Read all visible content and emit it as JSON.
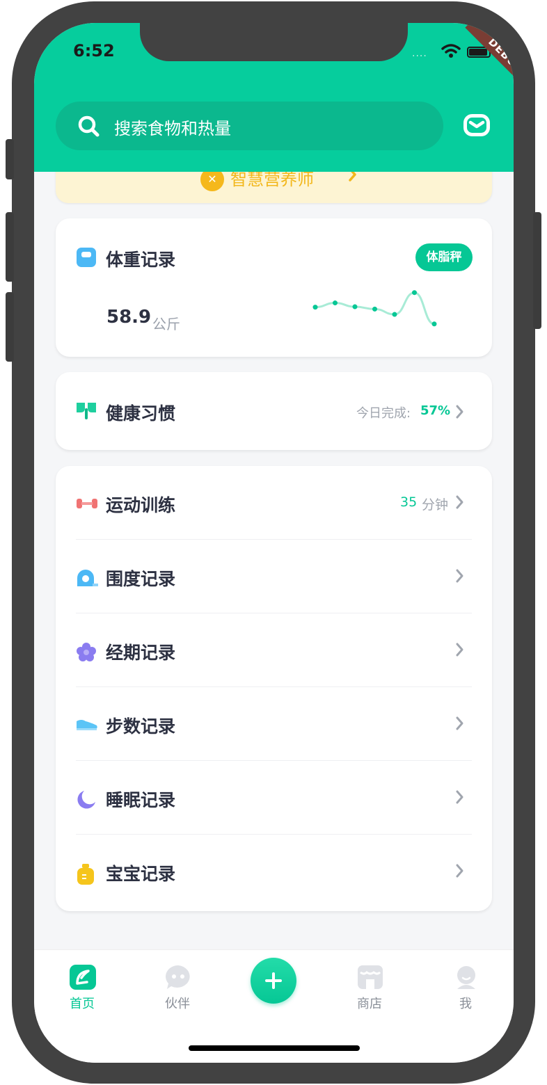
{
  "status_bar": {
    "time": "6:52",
    "signal_dots": "....",
    "debug_label": "DEBUG"
  },
  "header": {
    "search_placeholder": "搜索食物和热量"
  },
  "banner": {
    "label": "智慧营养师"
  },
  "weight_card": {
    "title": "体重记录",
    "badge": "体脂秤",
    "value": "58.9",
    "unit": "公斤",
    "trend": [
      0.52,
      0.41,
      0.51,
      0.57,
      0.71,
      0.14,
      0.96
    ]
  },
  "habit_card": {
    "title": "健康习惯",
    "progress_label": "今日完成:",
    "progress_value": "57%"
  },
  "list": {
    "items": [
      {
        "title": "运动训练",
        "meta_value": "35",
        "meta_unit": "分钟",
        "icon": "dumbbell-icon"
      },
      {
        "title": "围度记录",
        "icon": "tape-measure-icon"
      },
      {
        "title": "经期记录",
        "icon": "flower-icon"
      },
      {
        "title": "步数记录",
        "icon": "shoe-icon"
      },
      {
        "title": "睡眠记录",
        "icon": "moon-icon"
      },
      {
        "title": "宝宝记录",
        "icon": "baby-bottle-icon"
      }
    ]
  },
  "tabbar": {
    "home": "首页",
    "partner": "伙伴",
    "shop": "商店",
    "me": "我"
  },
  "colors": {
    "brand": "#06cd9d",
    "accent": "#06c795",
    "banner_text": "#f2b71c"
  }
}
